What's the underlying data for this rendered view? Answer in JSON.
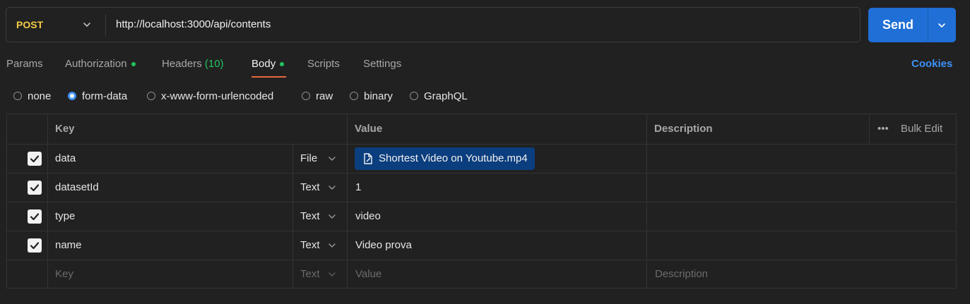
{
  "request": {
    "method": "POST",
    "url": "http://localhost:3000/api/contents",
    "send_label": "Send"
  },
  "tabs": [
    {
      "label": "Params",
      "active": false,
      "dot": false
    },
    {
      "label": "Authorization",
      "active": false,
      "dot": true
    },
    {
      "label": "Headers",
      "count": "(10)",
      "active": false,
      "dot": false
    },
    {
      "label": "Body",
      "active": true,
      "dot": true
    },
    {
      "label": "Scripts",
      "active": false,
      "dot": false
    },
    {
      "label": "Settings",
      "active": false,
      "dot": false
    }
  ],
  "cookies_label": "Cookies",
  "body_types": [
    {
      "label": "none",
      "selected": false
    },
    {
      "label": "form-data",
      "selected": true
    },
    {
      "label": "x-www-form-urlencoded",
      "selected": false
    },
    {
      "label": "raw",
      "selected": false
    },
    {
      "label": "binary",
      "selected": false
    },
    {
      "label": "GraphQL",
      "selected": false
    }
  ],
  "table": {
    "headers": {
      "key": "Key",
      "value": "Value",
      "description": "Description",
      "bulk_edit": "Bulk Edit"
    },
    "rows": [
      {
        "checked": true,
        "key": "data",
        "type": "File",
        "value": "Shortest Video on Youtube.mp4",
        "description": ""
      },
      {
        "checked": true,
        "key": "datasetId",
        "type": "Text",
        "value": "1",
        "description": ""
      },
      {
        "checked": true,
        "key": "type",
        "type": "Text",
        "value": "video",
        "description": ""
      },
      {
        "checked": true,
        "key": "name",
        "type": "Text",
        "value": "Video prova",
        "description": ""
      }
    ],
    "placeholder": {
      "key": "Key",
      "type": "Text",
      "value": "Value",
      "description": "Description"
    }
  },
  "colors": {
    "background": "#212121",
    "method": "#f5cb47",
    "send": "#1f6fd6",
    "accent_underline": "#e8693e",
    "status_dot": "#22c35e",
    "link": "#3d90f5",
    "file_chip": "#0b3e7e"
  }
}
